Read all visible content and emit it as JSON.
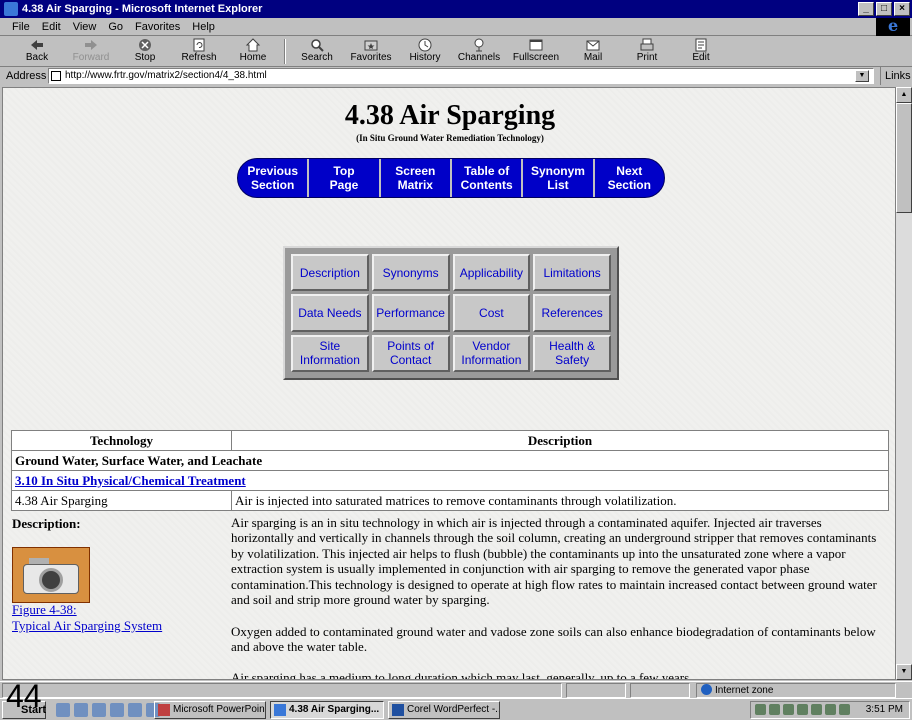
{
  "window": {
    "title": "4.38 Air Sparging - Microsoft Internet Explorer"
  },
  "menu": [
    "File",
    "Edit",
    "View",
    "Go",
    "Favorites",
    "Help"
  ],
  "toolbar": [
    "Back",
    "Forward",
    "Stop",
    "Refresh",
    "Home",
    "Search",
    "Favorites",
    "History",
    "Channels",
    "Fullscreen",
    "Mail",
    "Print",
    "Edit"
  ],
  "address": {
    "label": "Address",
    "url": "http://www.frtr.gov/matrix2/section4/4_38.html",
    "links": "Links"
  },
  "page": {
    "title": "4.38 Air Sparging",
    "subtitle": "(In Situ Ground Water Remediation Technology)",
    "nav": [
      [
        "Previous",
        "Section"
      ],
      [
        "Top",
        "Page"
      ],
      [
        "Screen",
        "Matrix"
      ],
      [
        "Table of",
        "Contents"
      ],
      [
        "Synonym",
        "List"
      ],
      [
        "Next",
        "Section"
      ]
    ],
    "grid": [
      [
        "Description"
      ],
      [
        "Synonyms"
      ],
      [
        "Applicability"
      ],
      [
        "Limitations"
      ],
      [
        "Data Needs"
      ],
      [
        "Performance"
      ],
      [
        "Cost"
      ],
      [
        "References"
      ],
      [
        "Site",
        "Information"
      ],
      [
        "Points of",
        "Contact"
      ],
      [
        "Vendor",
        "Information"
      ],
      [
        "Health &",
        "Safety"
      ]
    ],
    "table": {
      "headers": [
        "Technology",
        "Description"
      ],
      "category": "Ground Water, Surface Water, and Leachate",
      "link": "3.10 In Situ Physical/Chemical Treatment",
      "row": [
        "4.38 Air Sparging",
        "Air is injected into saturated matrices to remove contaminants through volatilization."
      ]
    },
    "desc_label": "Description:",
    "figure": [
      "Figure 4-38:",
      "Typical Air Sparging System"
    ],
    "paragraphs": [
      "Air sparging is an in situ technology in which air is injected through a contaminated aquifer. Injected air traverses horizontally and vertically in channels through the soil column, creating an underground stripper that removes contaminants by volatilization. This injected air helps to flush (bubble) the contaminants up into the unsaturated zone where a vapor extraction system is usually implemented in conjunction with air sparging to remove the generated vapor phase contamination.This technology is designed to operate at high flow rates to maintain increased contact between ground water and soil and strip more ground water by sparging.",
      "Oxygen added to contaminated ground water and vadose zone soils can also enhance biodegradation of contaminants below and above the water table.",
      "Air sparging has a medium to long duration which may last, generally, up to a few years."
    ]
  },
  "status": {
    "zone": "Internet zone"
  },
  "taskbar": {
    "start": "Start",
    "tasks": [
      "Microsoft PowerPoin...",
      "4.38 Air Sparging...",
      "Corel WordPerfect -..."
    ],
    "clock": "3:51 PM"
  },
  "slide_number": "44"
}
